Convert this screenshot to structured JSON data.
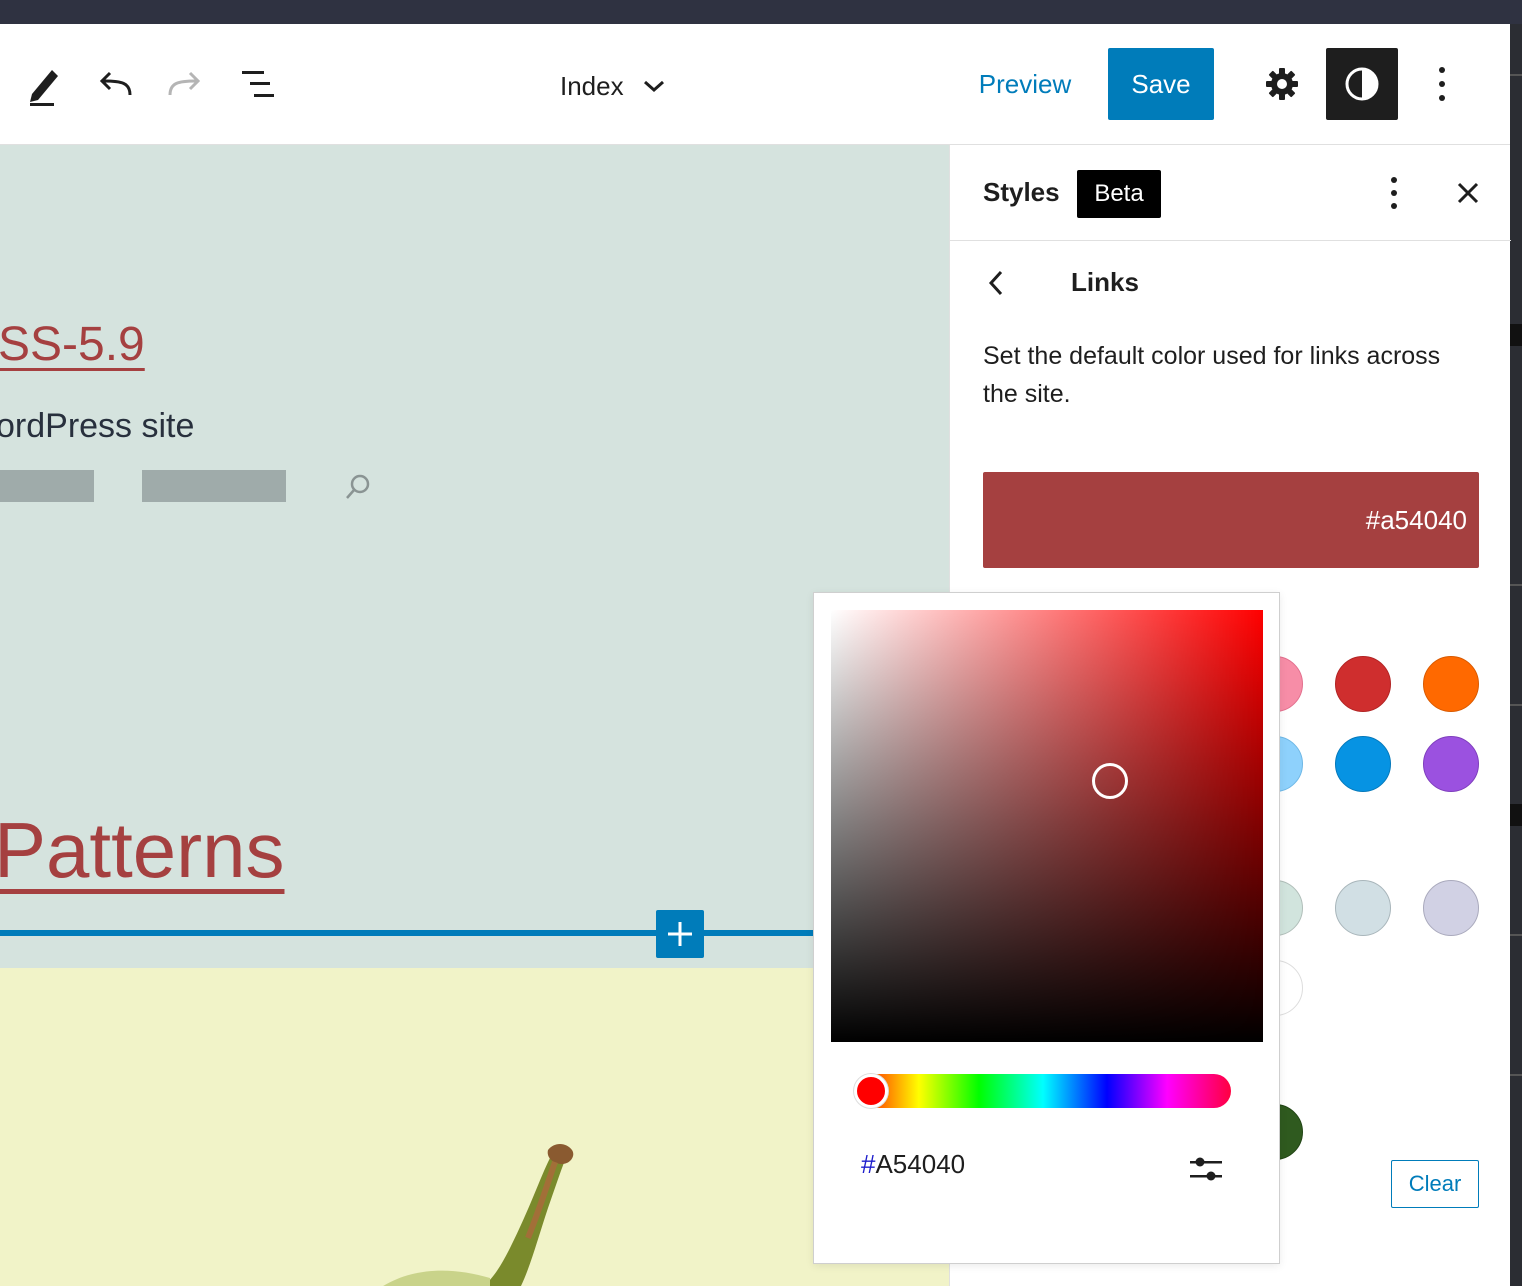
{
  "toolbar": {
    "template_title": "Index",
    "preview_label": "Preview",
    "save_label": "Save"
  },
  "canvas": {
    "site_title": "SS-5.9",
    "tagline": "ordPress site",
    "patterns_heading": "Patterns"
  },
  "sidebar": {
    "title": "Styles",
    "badge": "Beta",
    "panel_title": "Links",
    "description": "Set the default color used for links across the site.",
    "current_color_label": "#a54040",
    "clear_label": "Clear"
  },
  "color_picker": {
    "hex_prefix": "#",
    "hex_value": "A54040"
  },
  "colors": {
    "link": "#a54040",
    "accent": "#007cba",
    "canvas_bg": "#d5e3de",
    "yellow_block": "#f1f3c8"
  },
  "palette": [
    {
      "name": "pale-pink",
      "hex": "#f78da7"
    },
    {
      "name": "vivid-red",
      "hex": "#cf2e2e"
    },
    {
      "name": "luminous-vivid-orange",
      "hex": "#ff6900"
    },
    {
      "name": "pale-cyan-blue",
      "hex": "#8ed1fc"
    },
    {
      "name": "vivid-cyan-blue",
      "hex": "#0693e3"
    },
    {
      "name": "vivid-purple",
      "hex": "#9b51e0"
    },
    {
      "name": "green",
      "hex": "#d1e4dd"
    },
    {
      "name": "blue",
      "hex": "#d1dfe4"
    },
    {
      "name": "purple",
      "hex": "#d1d1e4"
    },
    {
      "name": "white",
      "hex": "#ffffff"
    },
    {
      "name": "dark-green",
      "hex": "#2f5a1f"
    }
  ]
}
